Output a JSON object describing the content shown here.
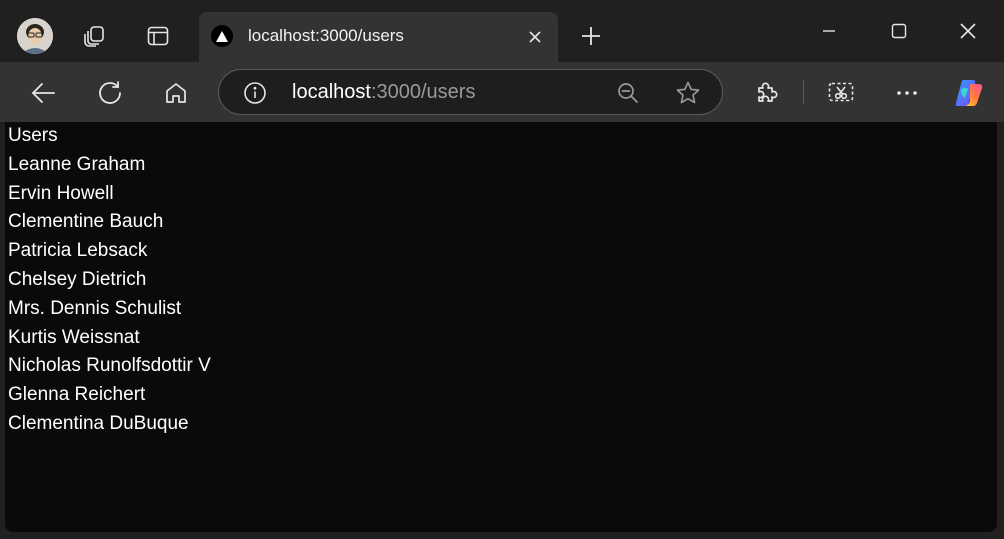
{
  "browser": {
    "tab": {
      "title": "localhost:3000/users"
    },
    "address_bar": {
      "host": "localhost",
      "path": ":3000/users"
    },
    "icons": {
      "profile": "profile-avatar",
      "workspaces": "workspaces-icon",
      "tab_actions": "tab-actions-icon",
      "favicon": "triangle-favicon",
      "close_tab": "close-icon",
      "new_tab": "plus-icon",
      "minimize": "minimize-icon",
      "maximize": "maximize-icon",
      "close_window": "close-icon",
      "back": "back-arrow-icon",
      "refresh": "refresh-icon",
      "home": "home-icon",
      "site_info": "info-icon",
      "zoom": "zoom-out-icon",
      "favorite": "star-icon",
      "extensions": "puzzle-icon",
      "screenshot": "screenshot-icon",
      "more": "more-dots-icon",
      "copilot": "copilot-icon"
    }
  },
  "page": {
    "heading": "Users",
    "users": [
      "Leanne Graham",
      "Ervin Howell",
      "Clementine Bauch",
      "Patricia Lebsack",
      "Chelsey Dietrich",
      "Mrs. Dennis Schulist",
      "Kurtis Weissnat",
      "Nicholas Runolfsdottir V",
      "Glenna Reichert",
      "Clementina DuBuque"
    ]
  }
}
